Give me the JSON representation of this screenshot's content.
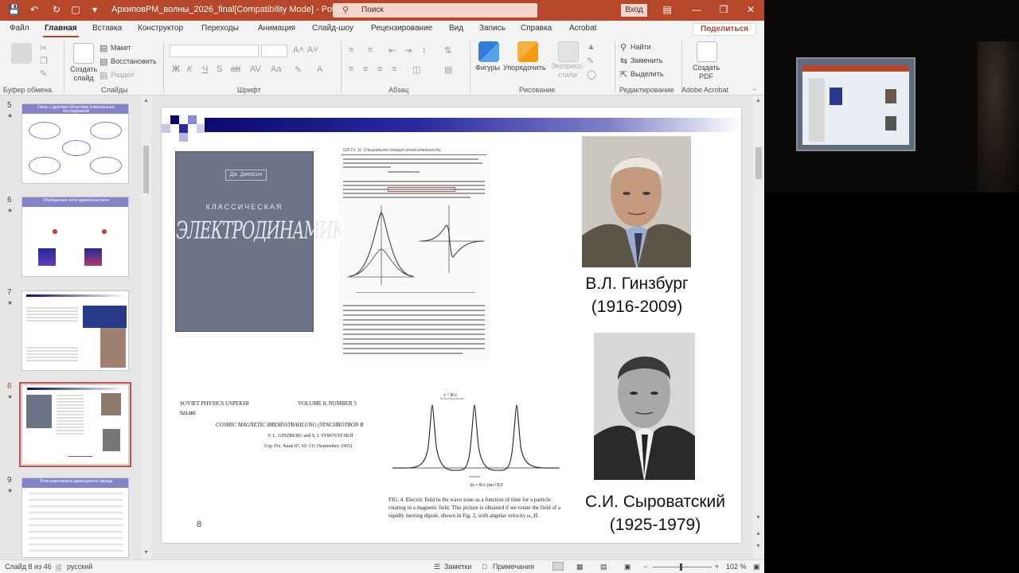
{
  "window": {
    "doc_title": "АрхиповРМ_волны_2026_final[Compatibility Mode]  -  PowerPoint",
    "search_placeholder": "Поиск",
    "signin": "Вход",
    "share": "Поделиться"
  },
  "tabs": [
    "Файл",
    "Главная",
    "Вставка",
    "Конструктор",
    "Переходы",
    "Анимация",
    "Слайд-шоу",
    "Рецензирование",
    "Вид",
    "Запись",
    "Справка",
    "Acrobat"
  ],
  "active_tab": "Главная",
  "ribbon": {
    "groups": {
      "clipboard": "Буфер обмена",
      "slides": "Слайды",
      "font": "Шрифт",
      "paragraph": "Абзац",
      "drawing": "Рисование",
      "editing": "Редактирование",
      "acrobat": "Adobe Acrobat"
    },
    "insert_label": "Вставить",
    "new_slide": "Создать\nслайд",
    "layout": "Макет",
    "reset": "Восстановить",
    "section": "Раздел",
    "shapes": "Фигуры",
    "arrange": "Упорядочить",
    "express_styles": "Экспресс-\nстили",
    "find": "Найти",
    "replace": "Заменить",
    "select": "Выделить",
    "create_pdf": "Создать\nPDF"
  },
  "thumbnails": [
    {
      "num": "5",
      "title": "Связь с другими областями современных исследований",
      "active": false
    },
    {
      "num": "6",
      "title": "Обобщенные поля двумерных волн",
      "active": false
    },
    {
      "num": "7",
      "title": "",
      "active": false
    },
    {
      "num": "8",
      "title": "",
      "active": true
    },
    {
      "num": "9",
      "title": "Поля равномерно движущегося заряда",
      "active": false
    }
  ],
  "slide": {
    "book_author": "Дж. Джексон",
    "book_title_1": "КЛАССИЧЕСКАЯ",
    "book_title_2": "ЭЛЕКТРОДИНАМИКА",
    "page_header": "620   Гл. 11. Специальная теория относительности",
    "ginzburg_name": "В.Л. Гинзбург",
    "ginzburg_years": "(1916-2009)",
    "syrovat_name": "С.И. Сыроватский",
    "syrovat_years": "(1925-1979)",
    "paper_journal": "SOVIET PHYSICS USPEKHI",
    "paper_volume": "VOLUME 8, NUMBER 5",
    "paper_code": "523.165",
    "paper_title": "COSMIC MAGNETIC BREMSSTRAHLUNG (SYNCHROTRON R",
    "paper_authors": "V. L. GINZBURG and S. I. SYROVAT-SKIĬ",
    "paper_ref": "Usp. Fiz. Nauk 87, 65–111 (September, 1965)",
    "fig_caption": "FIG. 4. Electric field in the wave zone as a function of time for a particle rotating in a magnetic field. This picture is obtained if we rotate the field of a rapidly moving dipole, shown in Fig. 2, with angular velocity ω_H.",
    "slide_number": "8"
  },
  "status": {
    "slide_counter": "Слайд 8 из 46",
    "language": "русский",
    "notes": "Заметки",
    "comments": "Примечания",
    "zoom": "102 %"
  },
  "colors": {
    "accent": "#b7472a",
    "slide_header": "#0a0a6e",
    "thumb_header": "#8583c8"
  }
}
